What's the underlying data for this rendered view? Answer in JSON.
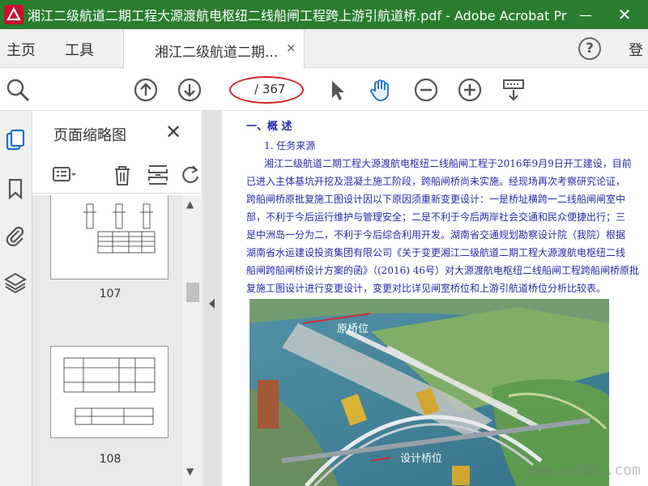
{
  "window": {
    "title": "湘江二级航道二期工程大源渡航电枢纽二线船闸工程跨上游引航道桥.pdf - Adobe Acrobat Pr",
    "min_symbol": "—",
    "close_symbol": "✕"
  },
  "menu": {
    "home": "主页",
    "tools": "工具",
    "signin": "登"
  },
  "tab": {
    "label": "湘江二级航道二期...",
    "close": "×"
  },
  "help_label": "?",
  "toolbar": {
    "page_value": "",
    "page_total": "/ 367"
  },
  "thumbnails": {
    "title": "页面缩略图",
    "close": "✕",
    "pages": [
      {
        "number": "107"
      },
      {
        "number": "108"
      }
    ]
  },
  "document": {
    "heading": "一、概  述",
    "subheading": "1. 任务来源",
    "lines": [
      "湘江二级航道二期工程大源渡航电枢纽二线船闸工程于2016年9月9日开工建设，目前",
      "已进入主体基坑开挖及混凝土施工阶段，跨船闸桥尚未实施。经现场再次考察研究论证，",
      "跨船闸桥原批复施工图设计因以下原因须重新变更设计：一是桥址横跨一二线船闸闸室中",
      "部，不利于今后运行维护与管理安全；二是不利于今后两岸社会交通和民众便捷出行；三",
      "是中洲岛一分为二，不利于今后综合利用开发。湖南省交通规划勘察设计院（我院）根据",
      "湖南省水运建设投资集团有限公司《关于变更湘江二级航道二期工程大源渡航电枢纽二线",
      "船闸跨船闸桥设计方案的函》（(2016) 46号）对大源渡航电枢纽二线船闸工程跨船闸桥原批",
      "复施工图设计进行变更设计，变更对比详见闸室桥位和上游引航道桥位分析比较表。"
    ],
    "figure": {
      "label_original": "原桥位",
      "label_design": "设计桥位"
    }
  },
  "watermark": "www.ecd2c.com",
  "colors": {
    "titlebar": "#2a7d2e",
    "accent_blue": "#2a2aa8",
    "annotation_red": "#d2232a"
  }
}
